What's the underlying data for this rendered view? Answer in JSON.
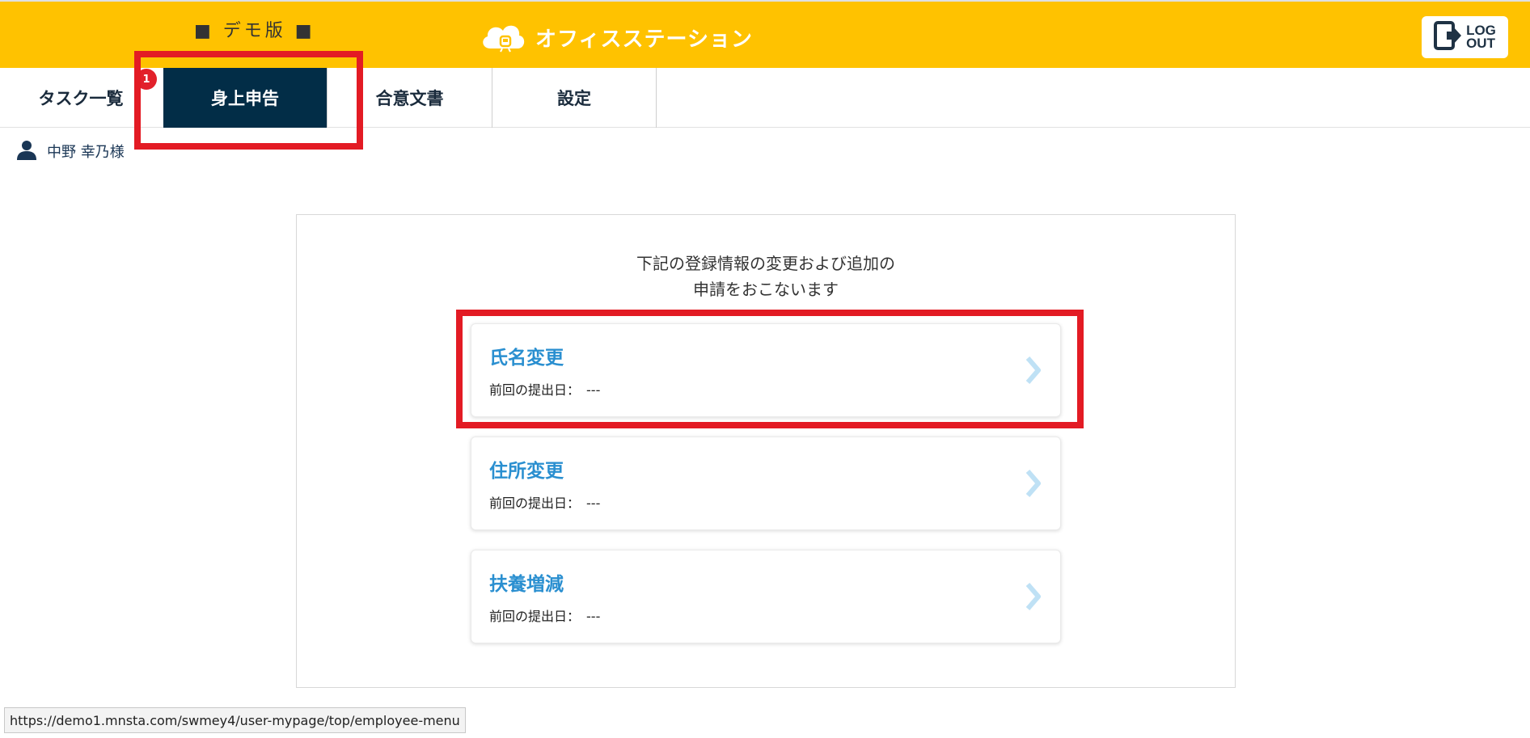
{
  "header": {
    "demo_label": "■ デモ版 ■",
    "brand": "オフィスステーション",
    "logout_label": "LOG\nOUT",
    "bg_color": "#ffc200"
  },
  "tabs": [
    {
      "label": "タスク一覧",
      "active": false
    },
    {
      "label": "身上申告",
      "active": true,
      "badge": "1"
    },
    {
      "label": "合意文書",
      "active": false
    },
    {
      "label": "設定",
      "active": false
    }
  ],
  "user": {
    "icon": "person-icon",
    "name": "中野 幸乃様"
  },
  "panel": {
    "intro_line1": "下記の登録情報の変更および追加の",
    "intro_line2": "申請をおこないます",
    "cards": [
      {
        "title": "氏名変更",
        "last_label": "前回の提出日：",
        "last_value": "---"
      },
      {
        "title": "住所変更",
        "last_label": "前回の提出日：",
        "last_value": "---"
      },
      {
        "title": "扶養増減",
        "last_label": "前回の提出日：",
        "last_value": "---"
      }
    ]
  },
  "status_url": "https://demo1.mnsta.com/swmey4/user-mypage/top/employee-menu",
  "colors": {
    "accent_dark": "#022d47",
    "card_title": "#2a8fd0",
    "highlight": "#e31b24",
    "badge": "#e2212b"
  }
}
